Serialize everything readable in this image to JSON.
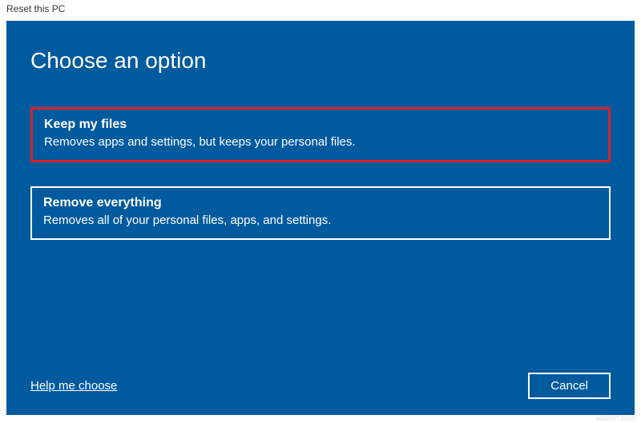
{
  "window": {
    "title": "Reset this PC"
  },
  "heading": "Choose an option",
  "options": [
    {
      "title": "Keep my files",
      "description": "Removes apps and settings, but keeps your personal files."
    },
    {
      "title": "Remove everything",
      "description": "Removes all of your personal files, apps, and settings."
    }
  ],
  "footer": {
    "help_link": "Help me choose",
    "cancel_label": "Cancel"
  },
  "watermark": "wsxdn.com"
}
